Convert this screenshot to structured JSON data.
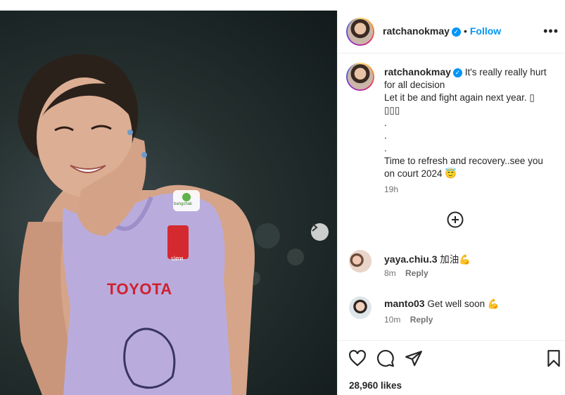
{
  "post": {
    "username": "ratchanokmay",
    "follow_label": "Follow",
    "more_label": "•••"
  },
  "caption": {
    "username": "ratchanokmay",
    "lines": [
      "It's really really hurt",
      "for all decision",
      "Let it be and fight again next year. ▯",
      "▯▯▯",
      ".",
      ".",
      ".",
      "Time to refresh and recovery..see you",
      "on court 2024 😇"
    ],
    "time": "19h"
  },
  "comments": [
    {
      "username": "yaya.chiu.3",
      "text": "加油💪",
      "time": "8m",
      "reply": "Reply"
    },
    {
      "username": "manto03",
      "text": "Get well soon 💪",
      "time": "10m",
      "reply": "Reply"
    }
  ],
  "photo": {
    "sponsor_text": "TOYOTA",
    "badge_text": "ปตท",
    "logo_text": "bangchak"
  },
  "actions": {
    "likes": "28,960 likes",
    "icons": [
      "heart-icon",
      "comment-icon",
      "share-icon",
      "save-icon"
    ]
  },
  "colors": {
    "accent": "#0095f6",
    "jersey": "#b7a9dc",
    "toyota": "#d0202e"
  }
}
